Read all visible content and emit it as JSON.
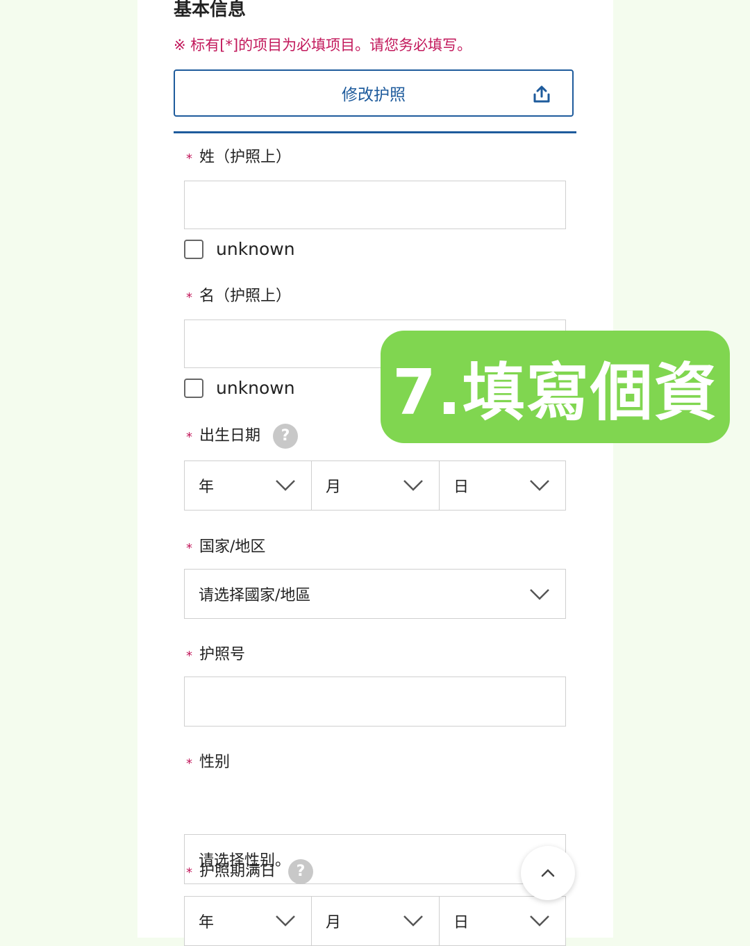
{
  "section_title": "基本信息",
  "required_note": "※ 标有[*]的项目为必填项目。请您务必填写。",
  "passport_button": {
    "label": "修改护照",
    "icon": "upload-icon"
  },
  "required_mark": "*",
  "fields": {
    "last_name": {
      "label": "姓（护照上）",
      "value": "",
      "unknown_label": "unknown",
      "unknown_checked": false
    },
    "first_name": {
      "label": "名（护照上）",
      "value": "",
      "unknown_label": "unknown",
      "unknown_checked": false
    },
    "birth_date": {
      "label": "出生日期",
      "help": "?",
      "year": "年",
      "month": "月",
      "day": "日"
    },
    "country": {
      "label": "国家/地区",
      "placeholder": "请选择國家/地區"
    },
    "passport_no": {
      "label": "护照号",
      "value": ""
    },
    "gender": {
      "label": "性别",
      "placeholder": "请选择性别。"
    },
    "expiry_date": {
      "label": "护照期满日",
      "help": "?",
      "year": "年",
      "month": "月",
      "day": "日"
    }
  },
  "banner": {
    "text": "7.填寫個資",
    "color": "#80d650"
  },
  "scroll_top_button": {
    "icon": "chevron-up-icon"
  },
  "colors": {
    "accent": "#1e5b9c",
    "required": "#c2185b",
    "background": "#f4fcee"
  }
}
